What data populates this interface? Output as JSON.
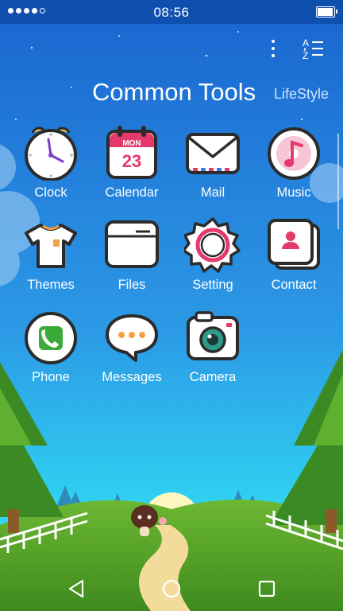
{
  "status_bar": {
    "time": "08:56",
    "signal_bars": 5,
    "signal_active": 4,
    "battery_level": 0.85
  },
  "header": {
    "title": "Common Tools",
    "subtitle": "LifeStyle",
    "menu_icon": "more-vertical-icon",
    "sort_icon": "sort-az-icon"
  },
  "apps": [
    {
      "label": "Clock",
      "icon": "clock-icon"
    },
    {
      "label": "Calendar",
      "icon": "calendar-icon",
      "month": "MON",
      "day": "23"
    },
    {
      "label": "Mail",
      "icon": "mail-icon"
    },
    {
      "label": "Music",
      "icon": "music-icon"
    },
    {
      "label": "Themes",
      "icon": "tshirt-icon"
    },
    {
      "label": "Files",
      "icon": "folder-icon"
    },
    {
      "label": "Setting",
      "icon": "gear-icon"
    },
    {
      "label": "Contact",
      "icon": "contact-icon"
    },
    {
      "label": "Phone",
      "icon": "phone-icon"
    },
    {
      "label": "Messages",
      "icon": "chat-icon"
    },
    {
      "label": "Camera",
      "icon": "camera-icon"
    }
  ],
  "nav_bar": {
    "back_icon": "back-icon",
    "home_icon": "home-icon",
    "recents_icon": "recents-icon"
  },
  "colors": {
    "sky_top": "#1f6fd6",
    "sky_bottom": "#2ad0f0",
    "grass": "#5aa428",
    "accent_pink": "#e5396b"
  }
}
